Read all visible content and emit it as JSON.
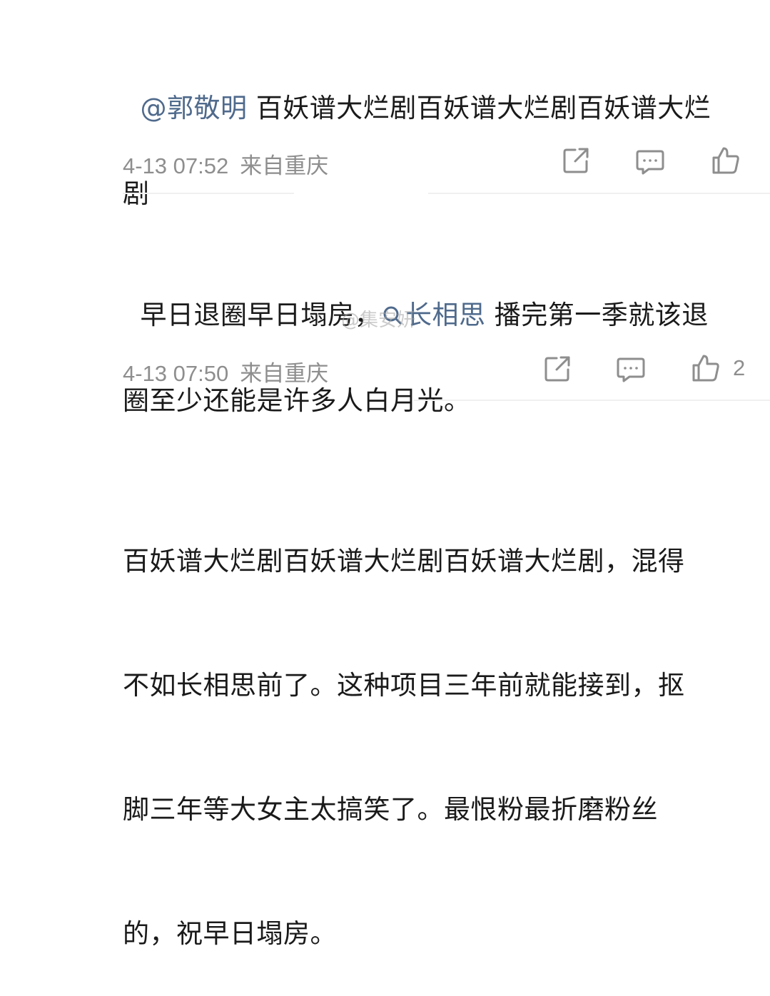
{
  "comments": [
    {
      "mention": "@郭敬明",
      "text_line1": " 百妖谱大烂剧百妖谱大烂剧百妖谱大烂",
      "text_line2": "剧",
      "date": "4-13 07:52",
      "location": "来自重庆"
    },
    {
      "text_before": "早日退圈早日塌房，",
      "topic": "长相思",
      "text_after": " 播完第一季就该退",
      "text_line2": "圈至少还能是许多人白月光。",
      "date": "4-13 07:50",
      "location": "来自重庆",
      "like_count": "2"
    },
    {
      "lines": [
        "百妖谱大烂剧百妖谱大烂剧百妖谱大烂剧，混得",
        "不如长相思前了。这种项目三年前就能接到，抠",
        "脚三年等大女主太搞笑了。最恨粉最折磨粉丝",
        "的，祝早日塌房。"
      ]
    }
  ],
  "watermark": "@集安妍",
  "icons": {
    "share": "share-icon",
    "comment": "comment-icon",
    "like": "like-icon",
    "search": "search-icon"
  },
  "colors": {
    "mention": "#4f6a8c",
    "meta": "#8e8e8e",
    "text": "#1a1a1a",
    "divider": "#f0f0f0"
  }
}
